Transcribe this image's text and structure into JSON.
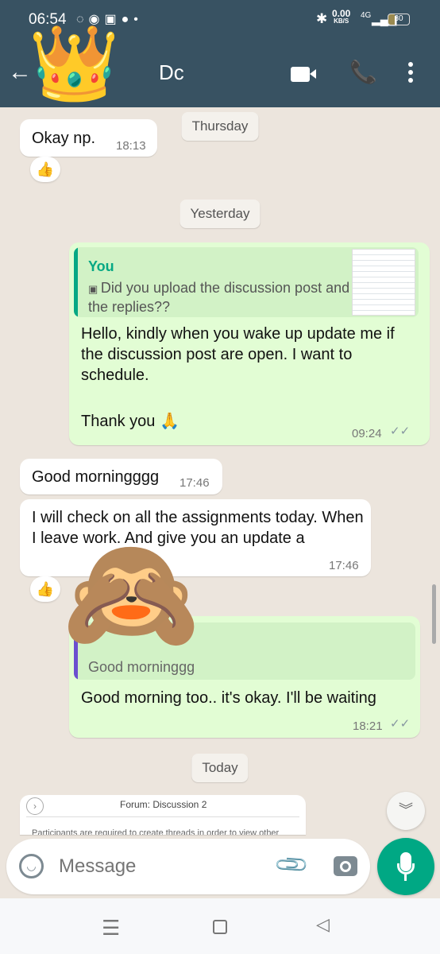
{
  "status_bar": {
    "time": "06:54",
    "net_speed": "0.00",
    "net_unit": "KB/S",
    "network": "4G",
    "battery": "30"
  },
  "header": {
    "contact_name": "Dc",
    "avatar_sticker": "crown-emoji"
  },
  "messages": [
    {
      "type": "date",
      "label": "Thursday"
    },
    {
      "type": "in",
      "text": "Okay np.",
      "time": "18:13",
      "reaction": "👍"
    },
    {
      "type": "date",
      "label": "Yesterday"
    },
    {
      "type": "out",
      "quote_author": "You",
      "quote_text": "Did you upload the discussion post and the replies??",
      "text": "Hello, kindly when you wake up update me if the discussion post are open. I want to schedule.",
      "text2": "Thank you 🙏",
      "time": "09:24"
    },
    {
      "type": "in",
      "text": "Good morningggg",
      "time": "17:46"
    },
    {
      "type": "in",
      "text": "I will check on all the assignments today. When I leave work. And give you an update a",
      "time": "17:46",
      "reaction": "👍"
    },
    {
      "type": "out",
      "quote_text": "Good morninggg",
      "text": "Good morning too.. it's okay. I'll be waiting",
      "time": "18:21",
      "sticker": "see-no-evil-monkey"
    },
    {
      "type": "date",
      "label": "Today"
    },
    {
      "type": "in",
      "image_title": "Forum: Discussion 2",
      "image_text": "Participants are required to create threads in order to view other"
    }
  ],
  "composer": {
    "placeholder": "Message"
  },
  "colors": {
    "header": "#385262",
    "accent": "#00a884",
    "outgoing": "#e2fdd4",
    "background": "#ece5dd"
  }
}
